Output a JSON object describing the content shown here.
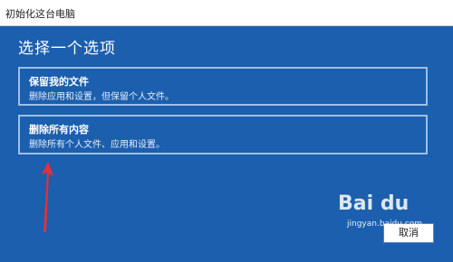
{
  "window": {
    "title": "初始化这台电脑"
  },
  "main": {
    "heading": "选择一个选项",
    "options": [
      {
        "title": "保留我的文件",
        "description": "删除应用和设置，但保留个人文件。"
      },
      {
        "title": "删除所有内容",
        "description": "删除所有个人文件、应用和设置。"
      }
    ],
    "cancel_label": "取消"
  },
  "watermark": {
    "logo": "Bai du",
    "url": "jingyan.baidu.com"
  },
  "colors": {
    "background": "#1b5fae",
    "option_border": "#9cc0ea",
    "annotation_arrow": "#e2313a"
  },
  "icons": {
    "annotation": "red-arrow-icon"
  }
}
